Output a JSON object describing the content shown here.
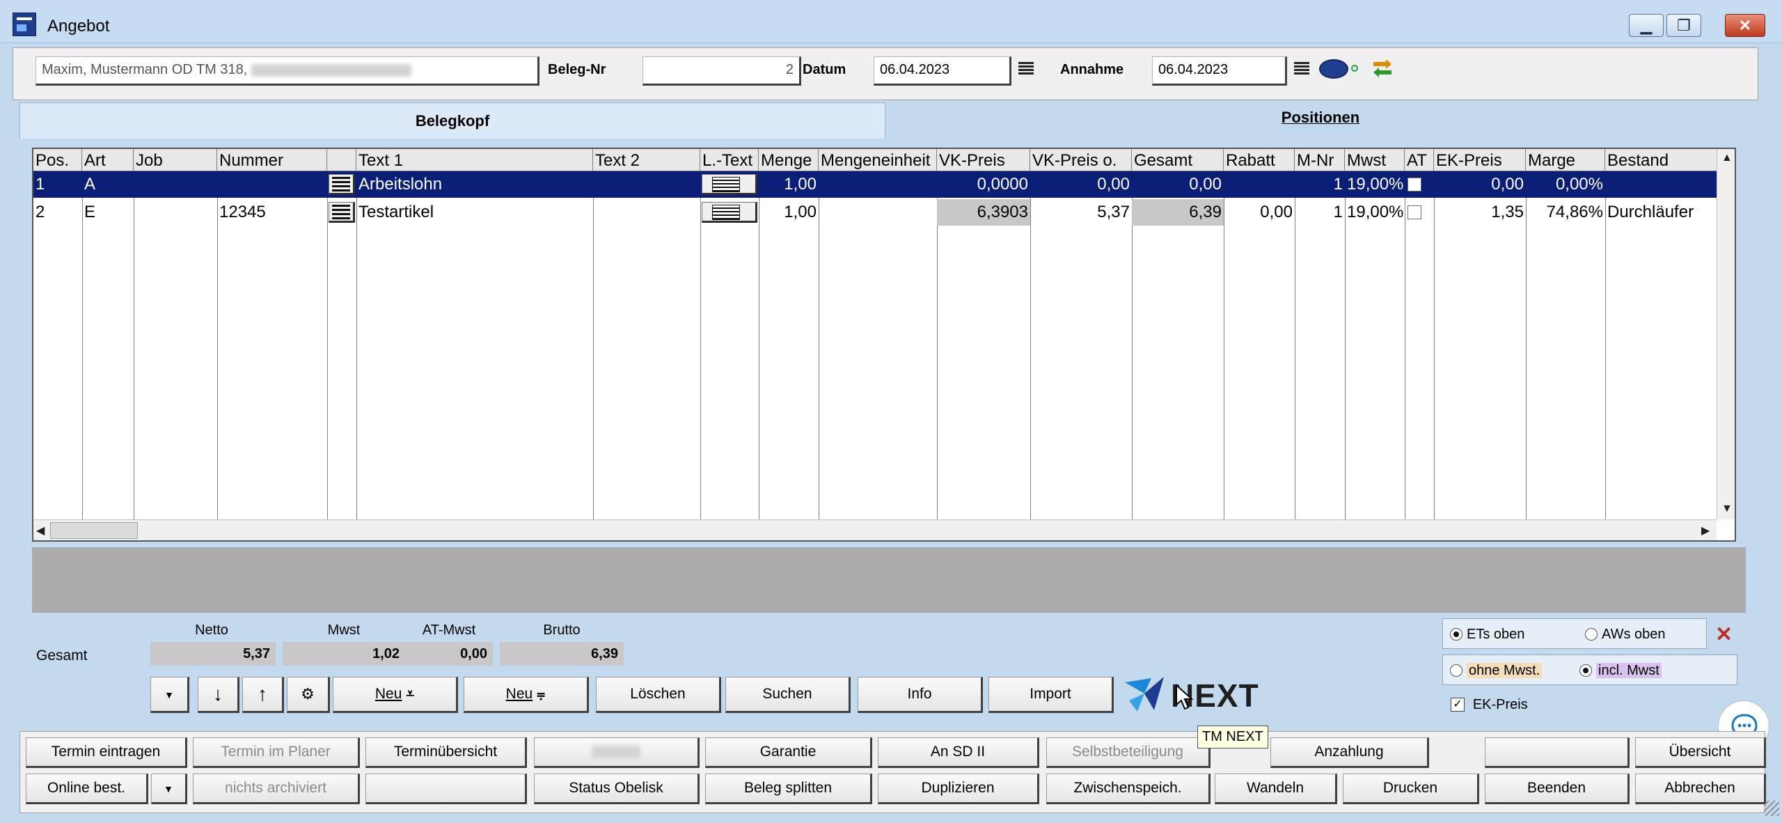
{
  "window": {
    "title": "Angebot",
    "minimize": "▭",
    "restore": "❐",
    "close": "✕"
  },
  "header": {
    "customer": "Maxim, Mustermann OD TM 318,",
    "beleg_nr_label": "Beleg-Nr",
    "beleg_nr": "2",
    "datum_label": "Datum",
    "datum": "06.04.2023",
    "annahme_label": "Annahme",
    "annahme": "06.04.2023"
  },
  "tabs": {
    "belegkopf": "Belegkopf",
    "positionen": "Positionen"
  },
  "grid": {
    "columns": [
      "Pos.",
      "Art",
      "Job",
      "Nummer",
      "",
      "Text 1",
      "Text 2",
      "L.-Text",
      "Menge",
      "Mengeneinheit",
      "VK-Preis",
      "VK-Preis o.",
      "Gesamt",
      "Rabatt",
      "M-Nr",
      "Mwst",
      "AT",
      "EK-Preis",
      "Marge",
      "Bestand"
    ],
    "rows": [
      {
        "pos": "1",
        "art": "A",
        "job": "",
        "nummer": "",
        "text1": "Arbeitslohn",
        "text2": "",
        "menge": "1,00",
        "einheit": "",
        "vk": "0,0000",
        "vk_o": "0,00",
        "gesamt": "0,00",
        "rabatt": "",
        "mnr": "1",
        "mwst": "19,00%",
        "ek": "0,00",
        "marge": "0,00%",
        "bestand": ""
      },
      {
        "pos": "2",
        "art": "E",
        "job": "",
        "nummer": "12345",
        "text1": "Testartikel",
        "text2": "",
        "menge": "1,00",
        "einheit": "",
        "vk": "6,3903",
        "vk_o": "5,37",
        "gesamt": "6,39",
        "rabatt": "0,00",
        "mnr": "1",
        "mwst": "19,00%",
        "ek": "1,35",
        "marge": "74,86%",
        "bestand": "Durchläufer"
      }
    ]
  },
  "totals": {
    "label": "Gesamt",
    "netto_label": "Netto",
    "netto": "5,37",
    "mwst_label": "Mwst",
    "mwst": "1,02",
    "at_mwst_label": "AT-Mwst",
    "at_mwst": "0,00",
    "brutto_label": "Brutto",
    "brutto": "6,39"
  },
  "mid_buttons": {
    "neu1": "Neu",
    "neu2": "Neu",
    "loeschen": "Löschen",
    "suchen": "Suchen",
    "info": "Info",
    "import": "Import"
  },
  "options": {
    "ets_oben": "ETs oben",
    "aws_oben": "AWs oben",
    "ohne_mwst": "ohne Mwst.",
    "incl_mwst": "incl. Mwst",
    "ek_preis": "EK-Preis"
  },
  "logo": {
    "text": "NEXT"
  },
  "tooltip": "TM NEXT",
  "footer": {
    "row1": [
      "Termin eintragen",
      "Termin im Planer",
      "Terminübersicht",
      "",
      "Garantie",
      "An SD II",
      "Selbstbeteiligung",
      "Anzahlung",
      "",
      "Übersicht"
    ],
    "row2": [
      "Online best.",
      "nichts archiviert",
      "",
      "Status Obelisk",
      "Beleg splitten",
      "Duplizieren",
      "Zwischenspeich.",
      "Wandeln",
      "Drucken",
      "Beenden",
      "Abbrechen"
    ]
  }
}
